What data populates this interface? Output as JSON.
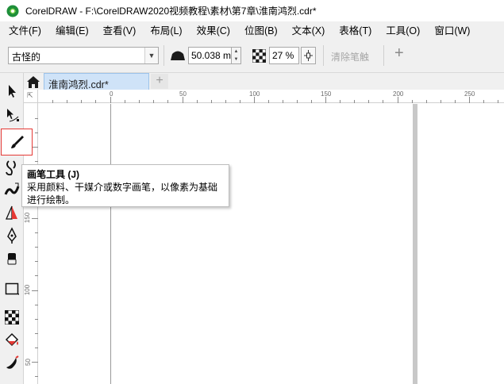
{
  "window": {
    "title": "CorelDRAW - F:\\CorelDRAW2020视频教程\\素材\\第7章\\淮南鸿烈.cdr*"
  },
  "menu": [
    "文件(F)",
    "编辑(E)",
    "查看(V)",
    "布局(L)",
    "效果(C)",
    "位图(B)",
    "文本(X)",
    "表格(T)",
    "工具(O)",
    "窗口(W)"
  ],
  "properties": {
    "style_preset": "古怪的",
    "brush_size": "50.038 mm",
    "transparency": "27 %",
    "clear_stroke_label": "清除笔触",
    "add_label": "+"
  },
  "tabs": {
    "document": "淮南鸿烈.cdr*",
    "new_tab": "+"
  },
  "rulers": {
    "horizontal": [
      "0",
      "50",
      "100",
      "150",
      "200",
      "250"
    ],
    "vertical": [
      "200",
      "150",
      "100",
      "50"
    ],
    "unit_glyph": "⇱"
  },
  "tooltip": {
    "title": "画笔工具 (J)",
    "description": "采用颜料、干媒介或数字画笔，以像素为基础进行绘制。"
  },
  "tools": [
    "pick-tool",
    "shape-tool",
    "paint-brush-tool",
    "freehand-tool",
    "artistic-media-tool",
    "dimension-tool",
    "pen-tool",
    "eraser-tool",
    "rectangle-tool",
    "transparency-tool",
    "fill-tool",
    "smart-fill-tool"
  ],
  "colors": {
    "accent_tab": "#cfe3f8",
    "selected_tool_border": "#e53935"
  }
}
